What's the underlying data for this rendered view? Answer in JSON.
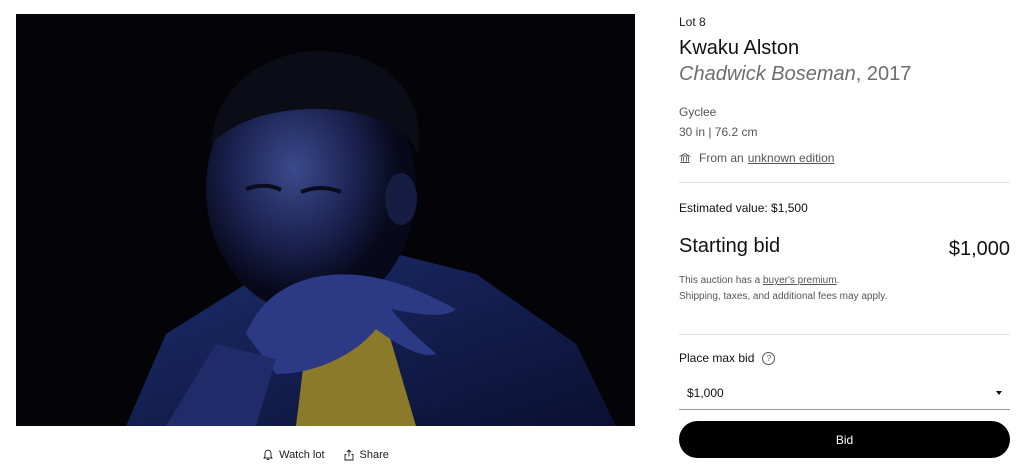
{
  "lot": {
    "label": "Lot 8"
  },
  "artwork": {
    "artist": "Kwaku Alston",
    "title": "Chadwick Boseman",
    "year_suffix": ", 2017",
    "medium": "Gyclee",
    "dimensions": "30 in | 76.2 cm",
    "edition_prefix": "From an",
    "edition_link": "unknown edition"
  },
  "pricing": {
    "estimated_value": "Estimated value: $1,500",
    "starting_bid_label": "Starting bid",
    "starting_bid_amount": "$1,000",
    "premium_prefix": "This auction has a",
    "premium_link": "buyer's premium",
    "premium_suffix": ".",
    "fees_note": "Shipping, taxes, and additional fees may apply."
  },
  "bid_form": {
    "max_bid_label": "Place max bid",
    "help_glyph": "?",
    "selected_value": "$1,000",
    "bid_button": "Bid"
  },
  "actions": {
    "watch_label": "Watch lot",
    "share_label": "Share"
  },
  "icons": {
    "watch": "bell-icon",
    "share": "share-icon",
    "edition": "institution-icon",
    "help": "help-circle-icon",
    "dropdown": "chevron-down-icon"
  },
  "colors": {
    "button_bg": "#000000",
    "button_text": "#ffffff",
    "muted_text": "#6d6d6d",
    "divider": "#e2e2e2"
  }
}
